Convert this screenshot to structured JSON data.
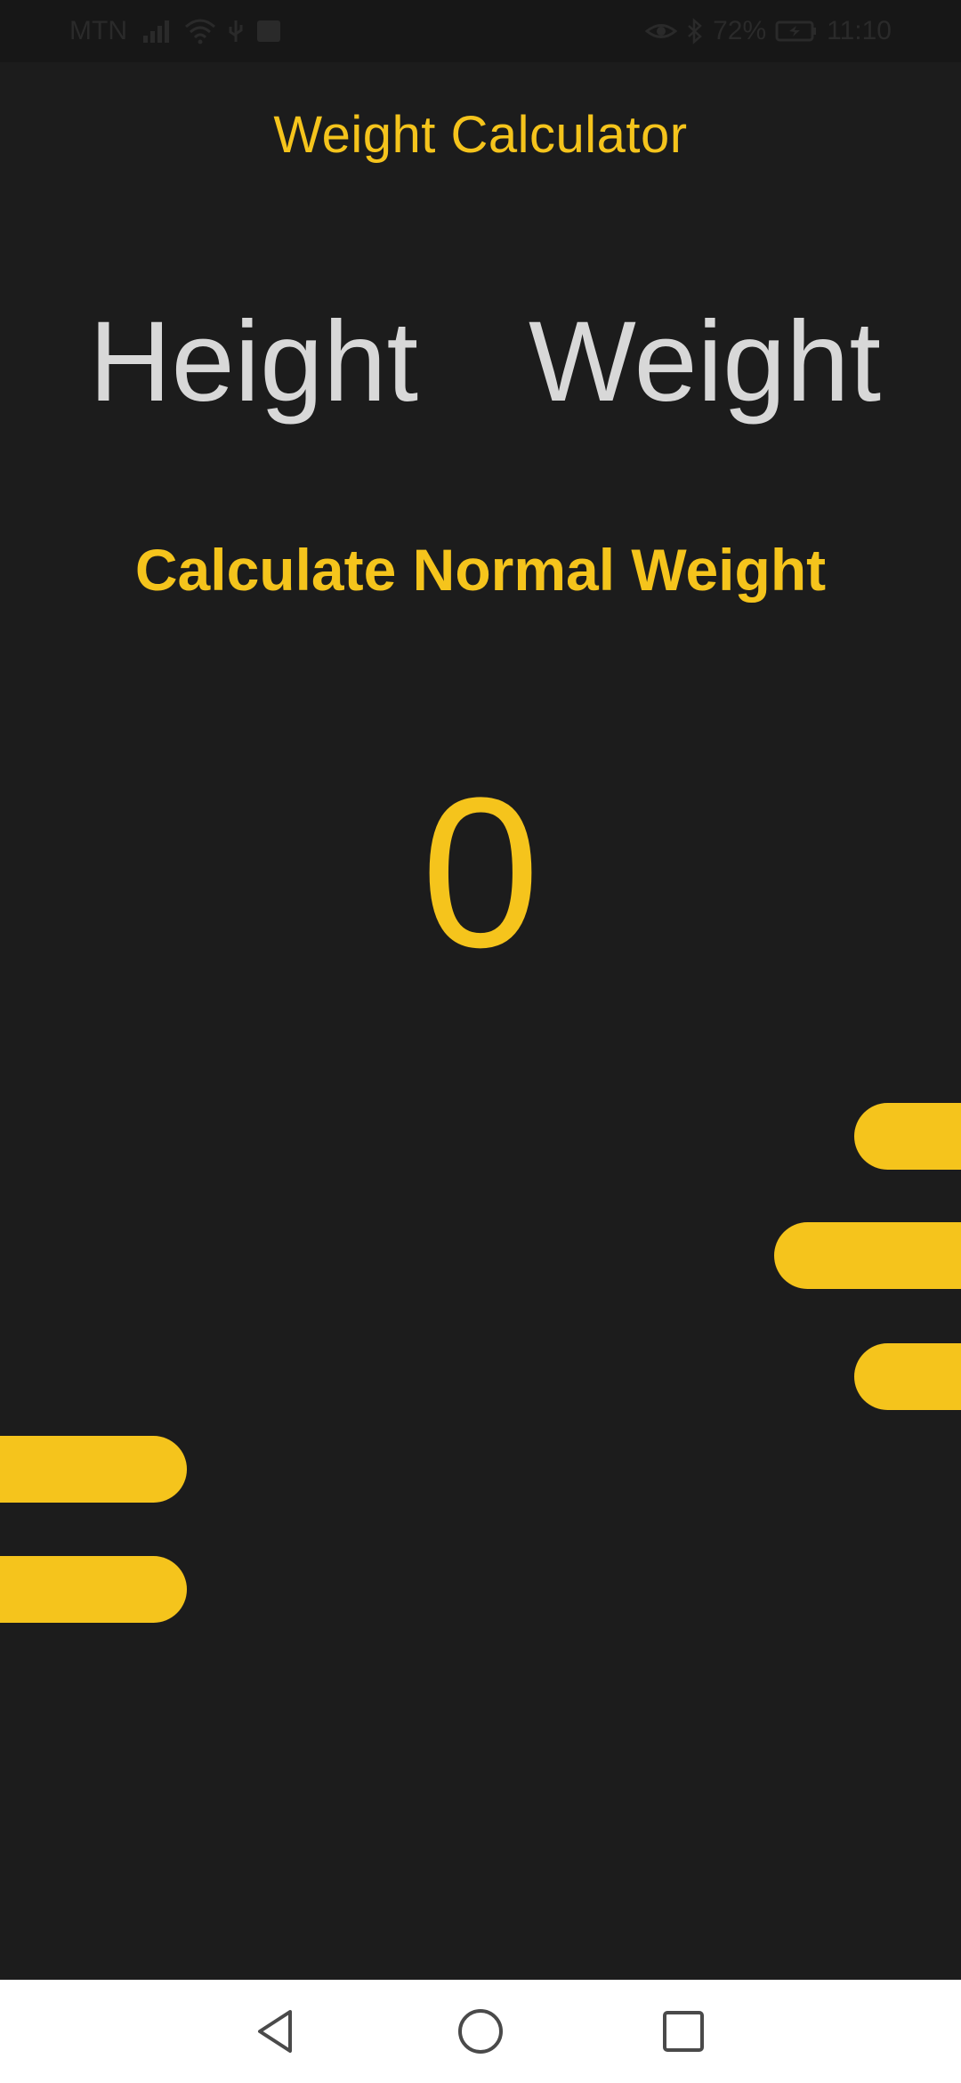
{
  "status_bar": {
    "carrier": "MTN",
    "battery": "72%",
    "time": "11:10"
  },
  "app": {
    "title": "Weight Calculator"
  },
  "inputs": {
    "height_label": "Height",
    "weight_label": "Weight"
  },
  "actions": {
    "calculate_label": "Calculate Normal Weight"
  },
  "result": {
    "value": "0"
  },
  "colors": {
    "accent": "#f5c41c",
    "background": "#1c1c1c",
    "label_text": "#d8d8d8"
  },
  "nav": {
    "icons": [
      "back-icon",
      "home-icon",
      "recents-icon"
    ]
  }
}
